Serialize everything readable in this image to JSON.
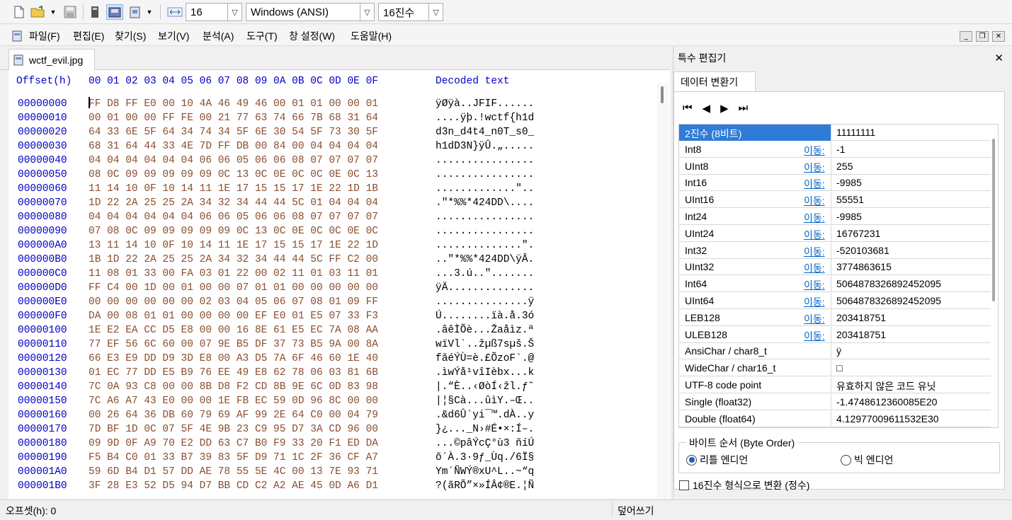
{
  "toolbar": {
    "bytes_per_row": "16",
    "charset": "Windows (ANSI)",
    "offset_base": "16진수",
    "icons": [
      "new-file-icon",
      "open-folder-icon",
      "save-icon",
      "properties-icon",
      "disk-editor-icon",
      "ram-editor-icon",
      "bytes-per-row-icon"
    ]
  },
  "menu": {
    "items": [
      "파일(F)",
      "편집(E)",
      "찾기(S)",
      "보기(V)",
      "분석(A)",
      "도구(T)",
      "창 설정(W)",
      "도움말(H)"
    ]
  },
  "file_tab": {
    "name": "wctf_evil.jpg"
  },
  "hex": {
    "header_offset": "Offset(h)",
    "header_columns": "00 01 02 03 04 05 06 07 08 09 0A 0B 0C 0D 0E 0F",
    "header_decoded": "Decoded text",
    "rows": [
      {
        "off": "00000000",
        "hex": "FF D8 FF E0 00 10 4A 46 49 46 00 01 01 00 00 01",
        "txt": "ÿØÿà..JFIF......"
      },
      {
        "off": "00000010",
        "hex": "00 01 00 00 FF FE 00 21 77 63 74 66 7B 68 31 64",
        "txt": "....ÿþ.!wctf{h1d"
      },
      {
        "off": "00000020",
        "hex": "64 33 6E 5F 64 34 74 34 5F 6E 30 54 5F 73 30 5F",
        "txt": "d3n_d4t4_n0T_s0_"
      },
      {
        "off": "00000030",
        "hex": "68 31 64 44 33 4E 7D FF DB 00 84 00 04 04 04 04",
        "txt": "h1dD3N}ÿÛ.„....."
      },
      {
        "off": "00000040",
        "hex": "04 04 04 04 04 04 06 06 05 06 06 08 07 07 07 07",
        "txt": "................"
      },
      {
        "off": "00000050",
        "hex": "08 0C 09 09 09 09 09 0C 13 0C 0E 0C 0C 0E 0C 13",
        "txt": "................"
      },
      {
        "off": "00000060",
        "hex": "11 14 10 0F 10 14 11 1E 17 15 15 17 1E 22 1D 1B",
        "txt": ".............\".."
      },
      {
        "off": "00000070",
        "hex": "1D 22 2A 25 25 2A 34 32 34 44 44 5C 01 04 04 04",
        "txt": ".\"*%%*424DD\\...."
      },
      {
        "off": "00000080",
        "hex": "04 04 04 04 04 04 06 06 05 06 06 08 07 07 07 07",
        "txt": "................"
      },
      {
        "off": "00000090",
        "hex": "07 08 0C 09 09 09 09 09 0C 13 0C 0E 0C 0C 0E 0C",
        "txt": "................"
      },
      {
        "off": "000000A0",
        "hex": "13 11 14 10 0F 10 14 11 1E 17 15 15 17 1E 22 1D",
        "txt": "..............\"."
      },
      {
        "off": "000000B0",
        "hex": "1B 1D 22 2A 25 25 2A 34 32 34 44 44 5C FF C2 00",
        "txt": "..\"*%%*424DD\\ÿÂ."
      },
      {
        "off": "000000C0",
        "hex": "11 08 01 33 00 FA 03 01 22 00 02 11 01 03 11 01",
        "txt": "...3.ú..\"......."
      },
      {
        "off": "000000D0",
        "hex": "FF C4 00 1D 00 01 00 00 07 01 01 00 00 00 00 00",
        "txt": "ÿÄ.............."
      },
      {
        "off": "000000E0",
        "hex": "00 00 00 00 00 00 02 03 04 05 06 07 08 01 09 FF",
        "txt": "...............ÿ"
      },
      {
        "off": "000000F0",
        "hex": "DA 00 08 01 01 00 00 00 00 EF E0 01 E5 07 33 F3",
        "txt": "Ú........ïà.å.3ó"
      },
      {
        "off": "00000100",
        "hex": "1E E2 EA CC D5 E8 00 00 16 8E 61 E5 EC 7A 08 AA",
        "txt": ".âêÌÕè...Žaåìz.ª"
      },
      {
        "off": "00000110",
        "hex": "77 EF 56 6C 60 00 07 9E B5 DF 37 73 B5 9A 00 8A",
        "txt": "wïVl`..žµß7sµš.Š"
      },
      {
        "off": "00000120",
        "hex": "66 E3 E9 DD D9 3D E8 00 A3 D5 7A 6F 46 60 1E 40",
        "txt": "fãéÝÙ=è.£ÕzoF`.@"
      },
      {
        "off": "00000130",
        "hex": "01 EC 77 DD E5 B9 76 EE 49 E8 62 78 06 03 81 6B",
        "txt": ".ìwÝå¹vîIèbx...k"
      },
      {
        "off": "00000140",
        "hex": "7C 0A 93 C8 00 00 8B D8 F2 CD 8B 9E 6C 0D 83 98",
        "txt": "|.“È..‹ØòÍ‹žl.ƒ˜"
      },
      {
        "off": "00000150",
        "hex": "7C A6 A7 43 E0 00 00 1E FB EC 59 0D 96 8C 00 00",
        "txt": "|¦§Cà...ûìY.–Œ.."
      },
      {
        "off": "00000160",
        "hex": "00 26 64 36 DB 60 79 69 AF 99 2E 64 C0 00 04 79",
        "txt": ".&d6Û`yi¯™.dÀ..y"
      },
      {
        "off": "00000170",
        "hex": "7D BF 1D 0C 07 5F 4E 9B 23 C9 95 D7 3A CD 96 00",
        "txt": "}¿..._N›#É•×:Í–."
      },
      {
        "off": "00000180",
        "hex": "09 9D 0F A9 70 E2 DD 63 C7 B0 F9 33 20 F1 ED DA",
        "txt": "...©pâÝcÇ°ù3 ñíÚ"
      },
      {
        "off": "00000190",
        "hex": "F5 B4 C0 01 33 B7 39 83 5F D9 71 1C 2F 36 CF A7",
        "txt": "õ´À.3·9ƒ_Ùq./6Ï§"
      },
      {
        "off": "000001A0",
        "hex": "59 6D B4 D1 57 DD AE 78 55 5E 4C 00 13 7E 93 71",
        "txt": "Ym´ÑWÝ®xU^L..~“q"
      },
      {
        "off": "000001B0",
        "hex": "3F 28 E3 52 D5 94 D7 BB CD C2 A2 AE 45 0D A6 D1",
        "txt": "?(ãRÕ”×»ÍÂ¢®E.¦Ñ"
      }
    ]
  },
  "side_panel": {
    "title": "특수 편집기",
    "tab": "데이터 변환기",
    "move_label": "이동:",
    "grid": [
      {
        "label": "2진수 (8비트)",
        "value": "11111111",
        "move": false
      },
      {
        "label": "Int8",
        "value": "-1",
        "move": true
      },
      {
        "label": "UInt8",
        "value": "255",
        "move": true
      },
      {
        "label": "Int16",
        "value": "-9985",
        "move": true
      },
      {
        "label": "UInt16",
        "value": "55551",
        "move": true
      },
      {
        "label": "Int24",
        "value": "-9985",
        "move": true
      },
      {
        "label": "UInt24",
        "value": "16767231",
        "move": true
      },
      {
        "label": "Int32",
        "value": "-520103681",
        "move": true
      },
      {
        "label": "UInt32",
        "value": "3774863615",
        "move": true
      },
      {
        "label": "Int64",
        "value": "5064878326892452095",
        "move": true
      },
      {
        "label": "UInt64",
        "value": "5064878326892452095",
        "move": true
      },
      {
        "label": "LEB128",
        "value": "203418751",
        "move": true
      },
      {
        "label": "ULEB128",
        "value": "203418751",
        "move": true
      },
      {
        "label": "AnsiChar / char8_t",
        "value": "ÿ",
        "move": false
      },
      {
        "label": "WideChar / char16_t",
        "value": "□",
        "move": false
      },
      {
        "label": "UTF-8 code point",
        "value": "유효하지 않은 코드 유닛",
        "move": false
      },
      {
        "label": "Single (float32)",
        "value": "-1.4748612360085E20",
        "move": false
      },
      {
        "label": "Double (float64)",
        "value": "4.12977009611532E30",
        "move": false
      }
    ],
    "byte_order_title": "바이트 순서 (Byte Order)",
    "little_endian": "리틀 엔디언",
    "big_endian": "빅 엔디언",
    "hex_convert": "16진수 형식으로 변환 (정수)"
  },
  "status": {
    "offset": "오프셋(h): 0",
    "mode": "덮어쓰기"
  }
}
